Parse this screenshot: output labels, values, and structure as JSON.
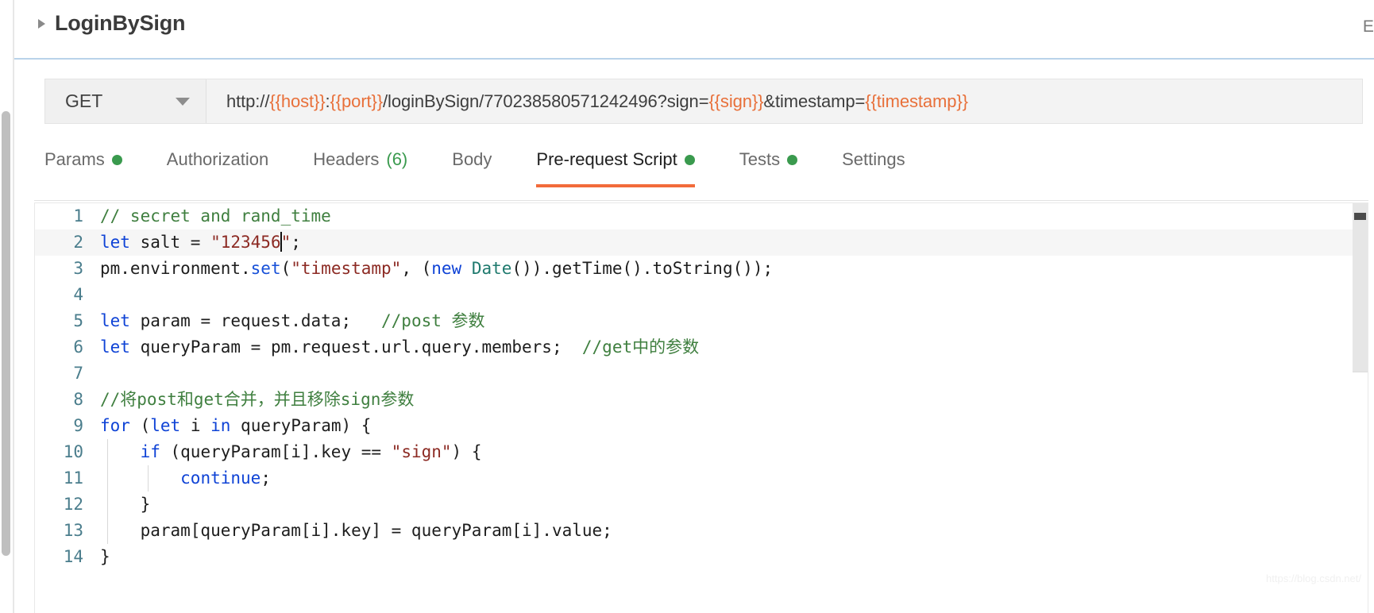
{
  "window": {
    "request_name": "LoginBySign",
    "examples_label": "Exa",
    "disclosure_icon": "triangle-right-icon"
  },
  "url_bar": {
    "method": "GET",
    "method_caret_icon": "chevron-down-icon",
    "url_segments": [
      {
        "text": "http://",
        "kind": "plain"
      },
      {
        "text": "{{host}}",
        "kind": "var"
      },
      {
        "text": ":",
        "kind": "plain"
      },
      {
        "text": "{{port}}",
        "kind": "var"
      },
      {
        "text": "/loginBySign/770238580571242496?sign=",
        "kind": "plain"
      },
      {
        "text": "{{sign}}",
        "kind": "var"
      },
      {
        "text": "&timestamp=",
        "kind": "plain"
      },
      {
        "text": "{{timestamp}}",
        "kind": "var"
      }
    ],
    "url_full": "http://{{host}}:{{port}}/loginBySign/770238580571242496?sign={{sign}}&timestamp={{timestamp}}"
  },
  "tabs": [
    {
      "label": "Params",
      "badge_dot": true,
      "count": null,
      "active": false
    },
    {
      "label": "Authorization",
      "badge_dot": false,
      "count": null,
      "active": false
    },
    {
      "label": "Headers",
      "badge_dot": false,
      "count": "(6)",
      "active": false
    },
    {
      "label": "Body",
      "badge_dot": false,
      "count": null,
      "active": false
    },
    {
      "label": "Pre-request Script",
      "badge_dot": true,
      "count": null,
      "active": true
    },
    {
      "label": "Tests",
      "badge_dot": true,
      "count": null,
      "active": false
    },
    {
      "label": "Settings",
      "badge_dot": false,
      "count": null,
      "active": false
    }
  ],
  "colors": {
    "accent": "#f26b3a",
    "dot_green": "#3a9a4e",
    "header_rule": "#b9d3ea",
    "url_variable": "#e8703a"
  },
  "editor": {
    "active_line": 2,
    "caret_line": 2,
    "lines": [
      {
        "n": "1",
        "tokens": [
          {
            "t": "// secret and rand_time",
            "c": "c-comment"
          }
        ]
      },
      {
        "n": "2",
        "tokens": [
          {
            "t": "let",
            "c": "c-kw"
          },
          {
            "t": " salt = ",
            "c": "c-plain"
          },
          {
            "t": "\"123456",
            "c": "c-str"
          },
          {
            "t": "|caret|",
            "c": "caret"
          },
          {
            "t": "\"",
            "c": "c-str"
          },
          {
            "t": ";",
            "c": "c-plain"
          }
        ]
      },
      {
        "n": "3",
        "tokens": [
          {
            "t": "pm.environment.",
            "c": "c-plain"
          },
          {
            "t": "set",
            "c": "c-fn"
          },
          {
            "t": "(",
            "c": "c-plain"
          },
          {
            "t": "\"timestamp\"",
            "c": "c-str"
          },
          {
            "t": ", (",
            "c": "c-plain"
          },
          {
            "t": "new",
            "c": "c-kw"
          },
          {
            "t": " ",
            "c": "c-plain"
          },
          {
            "t": "Date",
            "c": "c-type"
          },
          {
            "t": "()).getTime().toString());",
            "c": "c-plain"
          }
        ]
      },
      {
        "n": "4",
        "tokens": []
      },
      {
        "n": "5",
        "tokens": [
          {
            "t": "let",
            "c": "c-kw"
          },
          {
            "t": " param = request.data;   ",
            "c": "c-plain"
          },
          {
            "t": "//post 参数",
            "c": "c-comment"
          }
        ]
      },
      {
        "n": "6",
        "tokens": [
          {
            "t": "let",
            "c": "c-kw"
          },
          {
            "t": " queryParam = pm.request.url.query.members;  ",
            "c": "c-plain"
          },
          {
            "t": "//get中的参数",
            "c": "c-comment"
          }
        ]
      },
      {
        "n": "7",
        "tokens": []
      },
      {
        "n": "8",
        "tokens": [
          {
            "t": "//将post和get合并，并且移除sign参数",
            "c": "c-comment"
          }
        ]
      },
      {
        "n": "9",
        "tokens": [
          {
            "t": "for",
            "c": "c-kw"
          },
          {
            "t": " (",
            "c": "c-plain"
          },
          {
            "t": "let",
            "c": "c-kw"
          },
          {
            "t": " i ",
            "c": "c-plain"
          },
          {
            "t": "in",
            "c": "c-kw"
          },
          {
            "t": " queryParam) {",
            "c": "c-plain"
          }
        ]
      },
      {
        "n": "10",
        "tokens": [
          {
            "t": "    ",
            "c": "c-plain"
          },
          {
            "t": "if",
            "c": "c-kw"
          },
          {
            "t": " (queryParam[i].key == ",
            "c": "c-plain"
          },
          {
            "t": "\"sign\"",
            "c": "c-str"
          },
          {
            "t": ") {",
            "c": "c-plain"
          }
        ]
      },
      {
        "n": "11",
        "tokens": [
          {
            "t": "        ",
            "c": "c-plain"
          },
          {
            "t": "continue",
            "c": "c-kw"
          },
          {
            "t": ";",
            "c": "c-plain"
          }
        ]
      },
      {
        "n": "12",
        "tokens": [
          {
            "t": "    }",
            "c": "c-plain"
          }
        ]
      },
      {
        "n": "13",
        "tokens": [
          {
            "t": "    param[queryParam[i].key] = queryParam[i].value;",
            "c": "c-plain"
          }
        ]
      },
      {
        "n": "14",
        "tokens": [
          {
            "t": "}",
            "c": "c-plain"
          }
        ]
      }
    ]
  },
  "watermark": {
    "text": "https://blog.csdn.net/"
  }
}
